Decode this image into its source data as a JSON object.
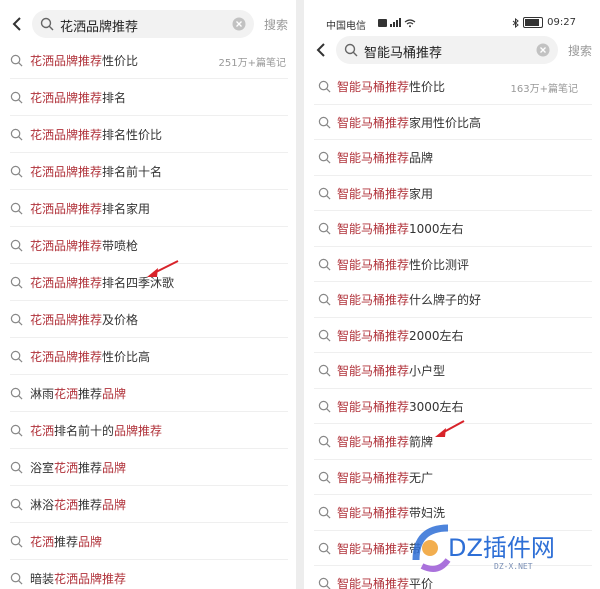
{
  "left": {
    "search": {
      "query": "花洒品牌推荐",
      "button": "搜索"
    },
    "rows": [
      {
        "hl": "花洒品牌推荐",
        "rest": "性价比",
        "meta": "251万+篇笔记"
      },
      {
        "hl": "花洒品牌推荐",
        "rest": "排名"
      },
      {
        "hl": "花洒品牌推荐",
        "rest": "排名性价比"
      },
      {
        "hl": "花洒品牌推荐",
        "rest": "排名前十名"
      },
      {
        "hl": "花洒品牌推荐",
        "rest": "排名家用"
      },
      {
        "hl": "花洒品牌推荐",
        "rest": "带喷枪"
      },
      {
        "hl": "花洒品牌推荐",
        "rest": "排名四季沐歌"
      },
      {
        "hl": "花洒品牌推荐",
        "rest": "及价格"
      },
      {
        "hl": "花洒品牌推荐",
        "rest": "性价比高"
      },
      {
        "segments": [
          {
            "t": "淋雨",
            "hl": false
          },
          {
            "t": "花洒",
            "hl": true
          },
          {
            "t": "推荐",
            "hl": false
          },
          {
            "t": "品牌",
            "hl": true
          }
        ]
      },
      {
        "segments": [
          {
            "t": "花洒",
            "hl": true
          },
          {
            "t": "排名前十的",
            "hl": false
          },
          {
            "t": "品牌推荐",
            "hl": true
          }
        ]
      },
      {
        "segments": [
          {
            "t": "浴室",
            "hl": false
          },
          {
            "t": "花洒",
            "hl": true
          },
          {
            "t": "推荐",
            "hl": false
          },
          {
            "t": "品牌",
            "hl": true
          }
        ]
      },
      {
        "segments": [
          {
            "t": "淋浴",
            "hl": false
          },
          {
            "t": "花洒",
            "hl": true
          },
          {
            "t": "推荐",
            "hl": false
          },
          {
            "t": "品牌",
            "hl": true
          }
        ]
      },
      {
        "segments": [
          {
            "t": "花洒",
            "hl": true
          },
          {
            "t": "推荐",
            "hl": false
          },
          {
            "t": "品牌",
            "hl": true
          }
        ]
      },
      {
        "segments": [
          {
            "t": "暗装",
            "hl": false
          },
          {
            "t": "花洒品牌推荐",
            "hl": true
          }
        ]
      }
    ]
  },
  "right": {
    "status": {
      "carrier": "中国电信",
      "time": "09:27"
    },
    "search": {
      "query": "智能马桶推荐",
      "button": "搜索"
    },
    "rows": [
      {
        "hl": "智能马桶推荐",
        "rest": "性价比",
        "meta": "163万+篇笔记"
      },
      {
        "hl": "智能马桶推荐",
        "rest": "家用性价比高"
      },
      {
        "hl": "智能马桶推荐",
        "rest": "品牌"
      },
      {
        "hl": "智能马桶推荐",
        "rest": "家用"
      },
      {
        "hl": "智能马桶推荐",
        "rest": "1000左右"
      },
      {
        "hl": "智能马桶推荐",
        "rest": "性价比测评"
      },
      {
        "hl": "智能马桶推荐",
        "rest": "什么牌子的好"
      },
      {
        "hl": "智能马桶推荐",
        "rest": "2000左右"
      },
      {
        "hl": "智能马桶推荐",
        "rest": "小户型"
      },
      {
        "hl": "智能马桶推荐",
        "rest": "3000左右"
      },
      {
        "hl": "智能马桶推荐",
        "rest": "箭牌"
      },
      {
        "hl": "智能马桶推荐",
        "rest": "无广"
      },
      {
        "hl": "智能马桶推荐",
        "rest": "带妇洗"
      },
      {
        "hl": "智能马桶推荐",
        "rest": "带"
      },
      {
        "hl": "智能马桶推荐",
        "rest": "平价"
      }
    ]
  },
  "watermark": {
    "text": "DZ插件网",
    "sub": "DZ-X.NET"
  },
  "colors": {
    "highlight": "#b0323a",
    "watermark": "#2e6fd6",
    "arrow": "#d8232a"
  },
  "icons": {
    "back": "chevron-left-icon",
    "search": "search-icon",
    "clear": "clear-icon"
  }
}
